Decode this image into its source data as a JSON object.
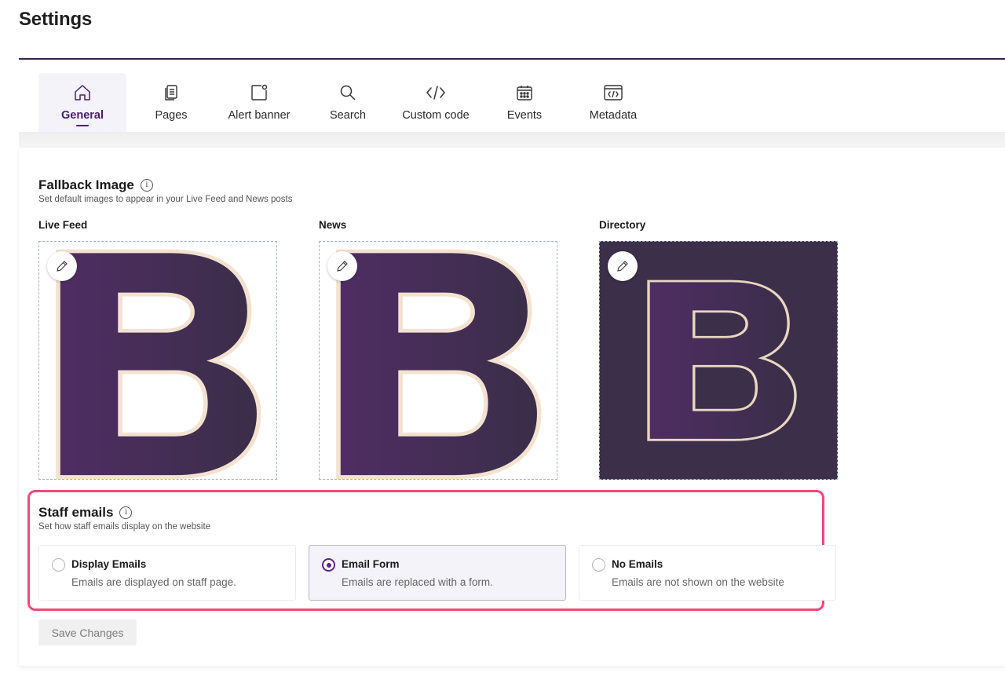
{
  "page": {
    "title": "Settings"
  },
  "tabs": [
    {
      "label": "General",
      "icon": "home-icon",
      "active": true
    },
    {
      "label": "Pages",
      "icon": "pages-icon"
    },
    {
      "label": "Alert banner",
      "icon": "alert-banner-icon"
    },
    {
      "label": "Search",
      "icon": "search-icon"
    },
    {
      "label": "Custom code",
      "icon": "code-icon"
    },
    {
      "label": "Events",
      "icon": "calendar-icon"
    },
    {
      "label": "Metadata",
      "icon": "metadata-icon"
    }
  ],
  "fallback": {
    "title": "Fallback Image",
    "subtitle": "Set default images to appear in your Live Feed and News posts",
    "images": [
      {
        "label": "Live Feed",
        "style": "light"
      },
      {
        "label": "News",
        "style": "light"
      },
      {
        "label": "Directory",
        "style": "dark"
      }
    ]
  },
  "staff_emails": {
    "title": "Staff emails",
    "subtitle": "Set how staff emails display on the website",
    "options": [
      {
        "title": "Display Emails",
        "desc": "Emails are displayed on staff page.",
        "selected": false
      },
      {
        "title": "Email Form",
        "desc": "Emails are replaced with a form.",
        "selected": true
      },
      {
        "title": "No Emails",
        "desc": "Emails are not shown on the website",
        "selected": false
      }
    ]
  },
  "actions": {
    "save_label": "Save Changes"
  },
  "colors": {
    "accent": "#4a1d6b",
    "highlight": "#f0497a",
    "logo_dark": "#3b2f4a",
    "logo_purple": "#4e2d62"
  }
}
